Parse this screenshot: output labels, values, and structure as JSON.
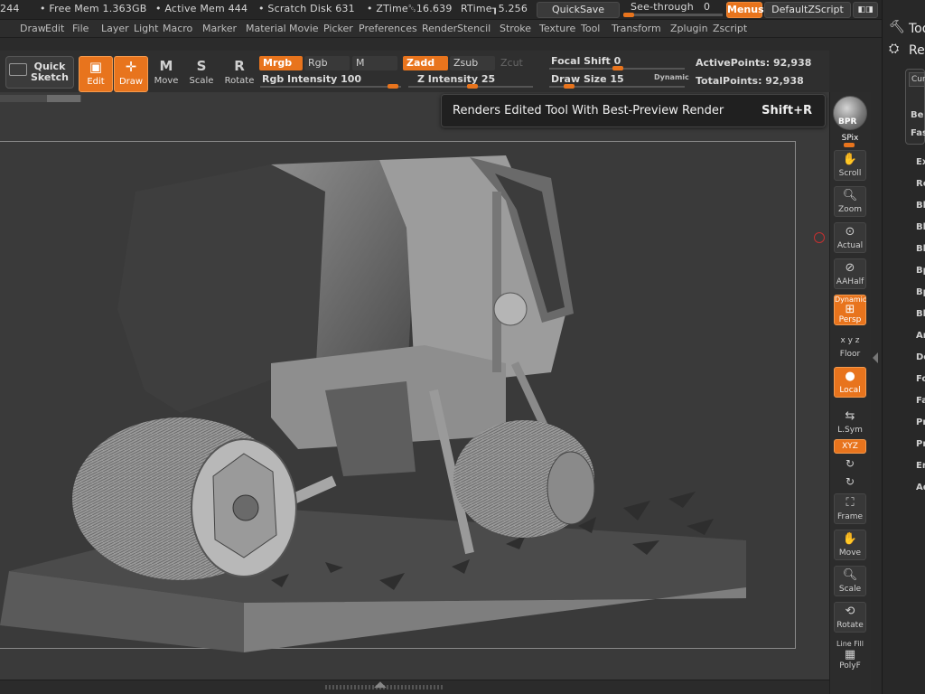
{
  "status": {
    "fragment": "244",
    "free_mem": "Free Mem 1.363GB",
    "active_mem": "Active Mem 444",
    "scratch": "Scratch Disk 631",
    "ztime": "ZTime␒16.639",
    "rtime": "RTime┒5.256",
    "quicksave": "QuickSave",
    "see_through_label": "See-through",
    "see_through_value": "0",
    "menus": "Menus",
    "default_zscript": "DefaultZScript"
  },
  "menu": [
    "Draw",
    "Edit",
    "File",
    "Layer",
    "Light",
    "Macro",
    "Marker",
    "Material",
    "Movie",
    "Picker",
    "Preferences",
    "Render",
    "Stencil",
    "Stroke",
    "Texture",
    "Tool",
    "Transform",
    "Zplugin",
    "Zscript"
  ],
  "shelf": {
    "quick_sketch": [
      "Quick",
      "Sketch"
    ],
    "tools": [
      {
        "label": "Edit",
        "glyph": "▣"
      },
      {
        "label": "Draw",
        "glyph": "✛"
      },
      {
        "label": "Move",
        "glyph": "M"
      },
      {
        "label": "Scale",
        "glyph": "S"
      },
      {
        "label": "Rotate",
        "glyph": "R"
      }
    ],
    "mrgb": "Mrgb",
    "rgb": "Rgb",
    "m": "M",
    "zadd": "Zadd",
    "zsub": "Zsub",
    "zcut": "Zcut",
    "rgb_intensity": "Rgb Intensity 100",
    "z_intensity": "Z Intensity 25",
    "focal_shift": "Focal Shift 0",
    "draw_size": "Draw Size 15",
    "dynamic": "Dynamic",
    "active_points": "ActivePoints: 92,938",
    "total_points": "TotalPoints: 92,938"
  },
  "tooltip": {
    "text": "Renders Edited Tool With Best-Preview Render",
    "shortcut": "Shift+R"
  },
  "dock": {
    "bpr": "BPR",
    "spix": "SPix",
    "scroll": "Scroll",
    "zoom": "Zoom",
    "actual": "Actual",
    "aahalf": "AAHalf",
    "dynamic": "Dynamic",
    "persp": "Persp",
    "floor": "Floor",
    "local": "Local",
    "lsym": "L.Sym",
    "xyz": "XYZ",
    "frame": "Frame",
    "move": "Move",
    "scale": "Scale",
    "rotate": "Rotate",
    "line_fill": "Line Fill",
    "polyf": "PolyF"
  },
  "right_panel": {
    "title_1": "Too",
    "title_2": "Ren",
    "current": "Cur",
    "items_top": [
      "Be",
      "Fas"
    ],
    "items": [
      "Ex",
      "Re",
      "Bl",
      "Bl",
      "Bl",
      "Bp",
      "Bp",
      "Bl",
      "Ar",
      "De",
      "Fo",
      "Fa",
      "Pr",
      "Pr",
      "En",
      "Ad"
    ]
  },
  "colors": {
    "accent": "#e8741d",
    "viewport": "#3a3a3a",
    "panel": "#2c2c2c"
  }
}
